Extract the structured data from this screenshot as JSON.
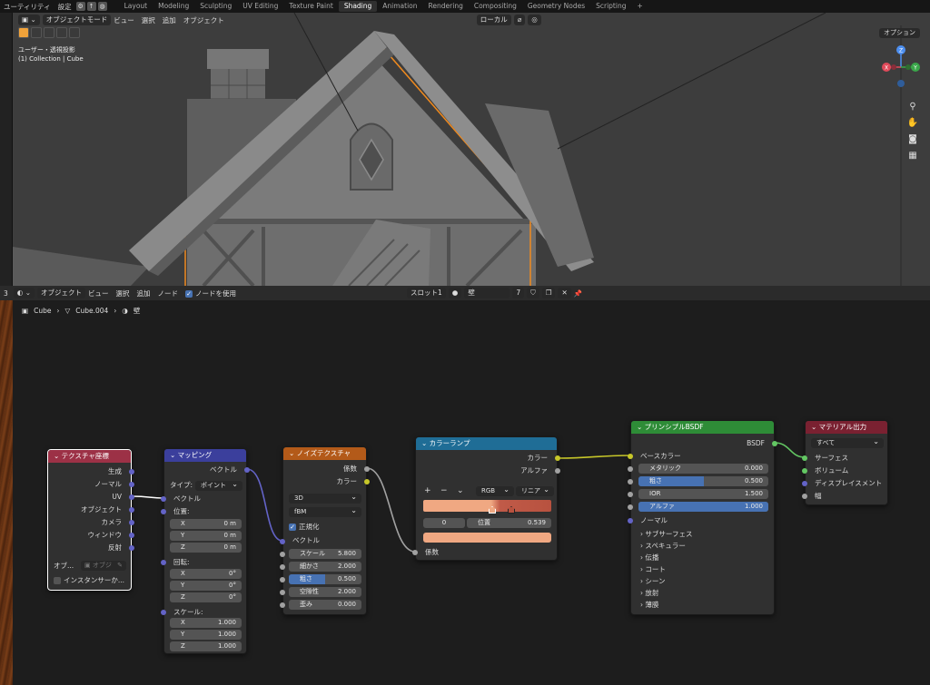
{
  "topbar": {
    "menus": [
      "ユーティリティ",
      "設定"
    ],
    "tabs": [
      "Layout",
      "Modeling",
      "Sculpting",
      "UV Editing",
      "Texture Paint",
      "Shading",
      "Animation",
      "Rendering",
      "Compositing",
      "Geometry Nodes",
      "Scripting"
    ],
    "active_tab": "Shading",
    "add_tab": "+"
  },
  "viewport": {
    "mode": "オブジェクトモード",
    "menus": [
      "ビュー",
      "選択",
      "追加",
      "オブジェクト"
    ],
    "orientation": "ローカル",
    "view_name": "ユーザー・透視投影",
    "collection": "(1) Collection | Cube",
    "options": "オプション",
    "gizmo": {
      "x": "X",
      "y": "Y",
      "z": "Z"
    }
  },
  "node_editor": {
    "area_number": "3",
    "type": "オブジェクト",
    "menus": [
      "ビュー",
      "選択",
      "追加",
      "ノード"
    ],
    "use_nodes": "ノードを使用",
    "slot": "スロット1",
    "material": "壁",
    "users": "7",
    "breadcrumb": [
      "Cube",
      "Cube.004",
      "壁"
    ]
  },
  "nodes": {
    "texcoord": {
      "title": "テクスチャ座標",
      "outputs": [
        "生成",
        "ノーマル",
        "UV",
        "オブジェクト",
        "カメラ",
        "ウィンドウ",
        "反射"
      ],
      "object_label": "オブ...",
      "object_placeholder": "オブジ",
      "instancer": "インスタンサーか..."
    },
    "mapping": {
      "title": "マッピング",
      "output": "ベクトル",
      "type_label": "タイプ:",
      "type_value": "ポイント",
      "input_vector": "ベクトル",
      "location_label": "位置:",
      "location": [
        {
          "axis": "X",
          "value": "0 m"
        },
        {
          "axis": "Y",
          "value": "0 m"
        },
        {
          "axis": "Z",
          "value": "0 m"
        }
      ],
      "rotation_label": "回転:",
      "rotation": [
        {
          "axis": "X",
          "value": "0°"
        },
        {
          "axis": "Y",
          "value": "0°"
        },
        {
          "axis": "Z",
          "value": "0°"
        }
      ],
      "scale_label": "スケール:",
      "scale": [
        {
          "axis": "X",
          "value": "1.000"
        },
        {
          "axis": "Y",
          "value": "1.000"
        },
        {
          "axis": "Z",
          "value": "1.000"
        }
      ]
    },
    "noise": {
      "title": "ノイズテクスチャ",
      "outputs": [
        "係数",
        "カラー"
      ],
      "dimensions": "3D",
      "type": "fBM",
      "normalize": "正規化",
      "input_vector": "ベクトル",
      "fields": [
        {
          "label": "スケール",
          "value": "5.800",
          "fill": 0
        },
        {
          "label": "細かさ",
          "value": "2.000",
          "fill": 0
        },
        {
          "label": "粗さ",
          "value": "0.500",
          "fill": 0.5
        },
        {
          "label": "空隙性",
          "value": "2.000",
          "fill": 0
        },
        {
          "label": "歪み",
          "value": "0.000",
          "fill": 0
        }
      ]
    },
    "colorramp": {
      "title": "カラーランプ",
      "outputs": [
        "カラー",
        "アルファ"
      ],
      "controls": [
        "+",
        "−",
        "⌄"
      ],
      "color_mode": "RGB",
      "interpolation": "リニア",
      "stop_index": "0",
      "position_label": "位置",
      "position_value": "0.539",
      "input": "係数",
      "stop_color": "#f0a882"
    },
    "bsdf": {
      "title": "プリンシプルBSDF",
      "output": "BSDF",
      "base_color": "ベースカラー",
      "fields": [
        {
          "label": "メタリック",
          "value": "0.000",
          "fill": 0
        },
        {
          "label": "粗さ",
          "value": "0.500",
          "fill": 0.5
        },
        {
          "label": "IOR",
          "value": "1.500",
          "fill": 0
        },
        {
          "label": "アルファ",
          "value": "1.000",
          "fill": 1
        }
      ],
      "normal": "ノーマル",
      "panels": [
        "サブサーフェス",
        "スペキュラー",
        "伝播",
        "コート",
        "シーン",
        "放射",
        "薄膜"
      ]
    },
    "output": {
      "title": "マテリアル出力",
      "target": "すべて",
      "inputs": [
        "サーフェス",
        "ボリューム",
        "ディスプレイスメント",
        "幅"
      ]
    }
  },
  "colors": {
    "texcoord_header": "#9c3146",
    "mapping_header": "#3b3f9c",
    "noise_header": "#b35a19",
    "colorramp_header": "#1f6d96",
    "bsdf_header": "#2e8c37",
    "output_header": "#7a2131"
  }
}
